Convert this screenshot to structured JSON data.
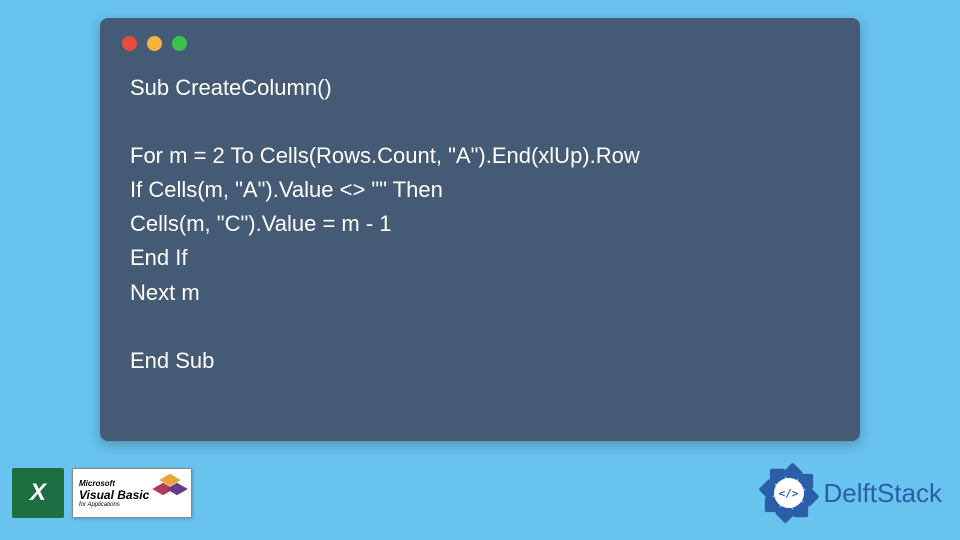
{
  "code": {
    "lines": "Sub CreateColumn()\n\nFor m = 2 To Cells(Rows.Count, \"A\").End(xlUp).Row\nIf Cells(m, \"A\").Value <> \"\" Then\nCells(m, \"C\").Value = m - 1\nEnd If\nNext m\n\nEnd Sub"
  },
  "logos": {
    "vb_microsoft": "Microsoft",
    "vb_name": "Visual Basic",
    "vb_sub": "for Applications",
    "delft_code": "</>",
    "delft_name": "DelftStack"
  }
}
